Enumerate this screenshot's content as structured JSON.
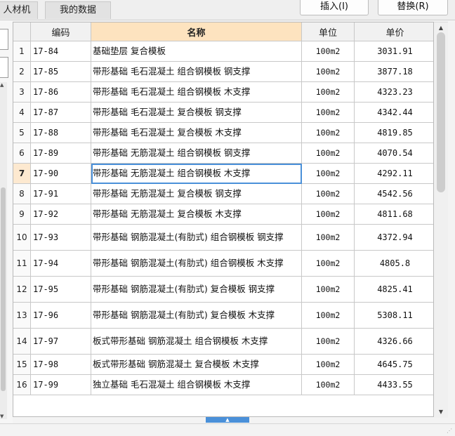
{
  "tabs": [
    {
      "label": "人材机"
    },
    {
      "label": "我的数据"
    }
  ],
  "toolbar": {
    "insert_label": "插入(I)",
    "replace_label": "替换(R)"
  },
  "table": {
    "columns": [
      "编码",
      "名称",
      "单位",
      "单价"
    ],
    "selected_index": 7,
    "rows": [
      {
        "idx": "1",
        "code": "17-84",
        "name": "基础垫层 复合模板",
        "unit": "100m2",
        "price": "3031.91"
      },
      {
        "idx": "2",
        "code": "17-85",
        "name": "带形基础 毛石混凝土 组合钢模板 钢支撑",
        "unit": "100m2",
        "price": "3877.18"
      },
      {
        "idx": "3",
        "code": "17-86",
        "name": "带形基础 毛石混凝土 组合钢模板 木支撑",
        "unit": "100m2",
        "price": "4323.23"
      },
      {
        "idx": "4",
        "code": "17-87",
        "name": "带形基础 毛石混凝土 复合模板 钢支撑",
        "unit": "100m2",
        "price": "4342.44"
      },
      {
        "idx": "5",
        "code": "17-88",
        "name": "带形基础 毛石混凝土 复合模板 木支撑",
        "unit": "100m2",
        "price": "4819.85"
      },
      {
        "idx": "6",
        "code": "17-89",
        "name": "带形基础 无筋混凝土 组合钢模板 钢支撑",
        "unit": "100m2",
        "price": "4070.54"
      },
      {
        "idx": "7",
        "code": "17-90",
        "name": "带形基础 无筋混凝土 组合钢模板 木支撑",
        "unit": "100m2",
        "price": "4292.11"
      },
      {
        "idx": "8",
        "code": "17-91",
        "name": "带形基础 无筋混凝土 复合模板 钢支撑",
        "unit": "100m2",
        "price": "4542.56"
      },
      {
        "idx": "9",
        "code": "17-92",
        "name": "带形基础 无筋混凝土 复合模板 木支撑",
        "unit": "100m2",
        "price": "4811.68"
      },
      {
        "idx": "10",
        "code": "17-93",
        "name": "带形基础 钢筋混凝土(有肋式) 组合钢模板 钢支撑",
        "unit": "100m2",
        "price": "4372.94"
      },
      {
        "idx": "11",
        "code": "17-94",
        "name": "带形基础 钢筋混凝土(有肋式) 组合钢模板 木支撑",
        "unit": "100m2",
        "price": "4805.8"
      },
      {
        "idx": "12",
        "code": "17-95",
        "name": "带形基础 钢筋混凝土(有肋式) 复合模板 钢支撑",
        "unit": "100m2",
        "price": "4825.41"
      },
      {
        "idx": "13",
        "code": "17-96",
        "name": "带形基础 钢筋混凝土(有肋式) 复合模板 木支撑",
        "unit": "100m2",
        "price": "5308.11"
      },
      {
        "idx": "14",
        "code": "17-97",
        "name": "板式带形基础 钢筋混凝土 组合钢模板 木支撑",
        "unit": "100m2",
        "price": "4326.66"
      },
      {
        "idx": "15",
        "code": "17-98",
        "name": "板式带形基础 钢筋混凝土 复合模板 木支撑",
        "unit": "100m2",
        "price": "4645.75"
      },
      {
        "idx": "16",
        "code": "17-99",
        "name": "独立基础 毛石混凝土 组合钢模板 木支撑",
        "unit": "100m2",
        "price": "4433.55"
      }
    ]
  },
  "icons": {
    "scroll_up": "triangle-up-icon",
    "scroll_down": "triangle-down-icon",
    "resize_grip": "resize-grip-icon"
  },
  "colors": {
    "header_highlight": "#fde3bf",
    "selection_border": "#4a90d9"
  }
}
